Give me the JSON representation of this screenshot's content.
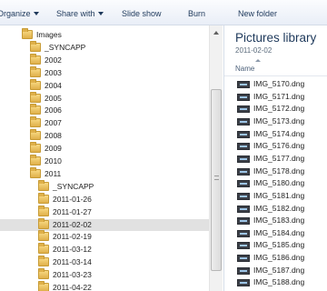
{
  "toolbar": {
    "organize": "Organize",
    "share_with": "Share with",
    "slide_show": "Slide show",
    "burn": "Burn",
    "new_folder": "New folder"
  },
  "nav": {
    "items": [
      {
        "label": "Images"
      },
      {
        "label": "_SYNCAPP"
      },
      {
        "label": "2002"
      },
      {
        "label": "2003"
      },
      {
        "label": "2004"
      },
      {
        "label": "2005"
      },
      {
        "label": "2006"
      },
      {
        "label": "2007"
      },
      {
        "label": "2008"
      },
      {
        "label": "2009"
      },
      {
        "label": "2010"
      },
      {
        "label": "2011"
      },
      {
        "label": "_SYNCAPP"
      },
      {
        "label": "2011-01-26"
      },
      {
        "label": "2011-01-27"
      },
      {
        "label": "2011-02-02",
        "selected": true
      },
      {
        "label": "2011-02-19"
      },
      {
        "label": "2011-03-12"
      },
      {
        "label": "2011-03-14"
      },
      {
        "label": "2011-03-23"
      },
      {
        "label": "2011-04-22"
      }
    ]
  },
  "content": {
    "library_title": "Pictures library",
    "library_subtitle": "2011-02-02",
    "column_name": "Name",
    "files": [
      "IMG_5170.dng",
      "IMG_5171.dng",
      "IMG_5172.dng",
      "IMG_5173.dng",
      "IMG_5174.dng",
      "IMG_5176.dng",
      "IMG_5177.dng",
      "IMG_5178.dng",
      "IMG_5180.dng",
      "IMG_5181.dng",
      "IMG_5182.dng",
      "IMG_5183.dng",
      "IMG_5184.dng",
      "IMG_5185.dng",
      "IMG_5186.dng",
      "IMG_5187.dng",
      "IMG_5188.dng"
    ]
  },
  "colors": {
    "toolbar_text": "#1e395b",
    "selected_bg": "#e1e1e1",
    "folder": "#f7d983"
  }
}
